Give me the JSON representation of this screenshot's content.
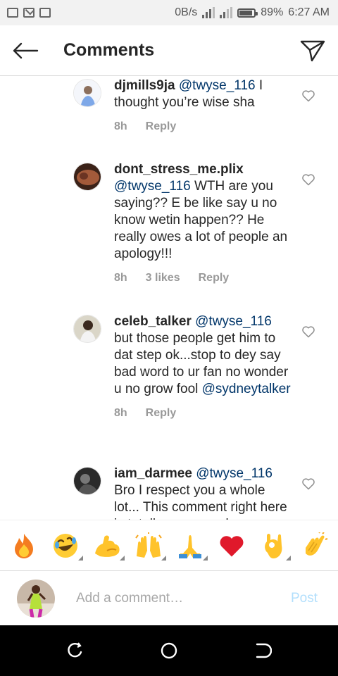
{
  "status_bar": {
    "net_speed": "0B/s",
    "battery": "89%",
    "time": "6:27 AM",
    "battery_level": 0.89
  },
  "header": {
    "title": "Comments",
    "back_icon": "arrow-left-icon",
    "send_icon": "direct-send-icon"
  },
  "comments": [
    {
      "username": "djmills9ja",
      "mention": "@twyse_116",
      "text_after_mention": " I thought you’re wise sha",
      "extra_mention": "",
      "time": "8h",
      "likes": "",
      "reply": "Reply"
    },
    {
      "username": "dont_stress_me.plix",
      "mention": "@twyse_116",
      "text_after_mention": " WTH are you saying?? E be like say u no know wetin happen?? He really owes a lot of people an apology!!!",
      "extra_mention": "",
      "time": "8h",
      "likes": "3 likes",
      "reply": "Reply"
    },
    {
      "username": "celeb_talker",
      "mention": "@twyse_116",
      "text_after_mention": " but those people get him to dat step ok...stop to dey say bad word to ur fan no wonder u no grow fool",
      "extra_mention": "@sydneytalker",
      "time": "8h",
      "likes": "",
      "reply": "Reply"
    },
    {
      "username": "iam_darmee",
      "mention": "@twyse_116",
      "text_after_mention": " Bro I respect you a whole lot... This comment right here is totally wrong and",
      "extra_mention": "",
      "time": "",
      "likes": "",
      "reply": ""
    }
  ],
  "emoji_bar": [
    "🔥",
    "🤣",
    "💪",
    "🙌",
    "🙏",
    "❤️",
    "👌",
    "👏"
  ],
  "input": {
    "placeholder": "Add a comment…",
    "value": "",
    "post_label": "Post"
  },
  "colors": {
    "mention": "#003569",
    "meta": "#999999",
    "post_disabled": "#b2dffc"
  }
}
